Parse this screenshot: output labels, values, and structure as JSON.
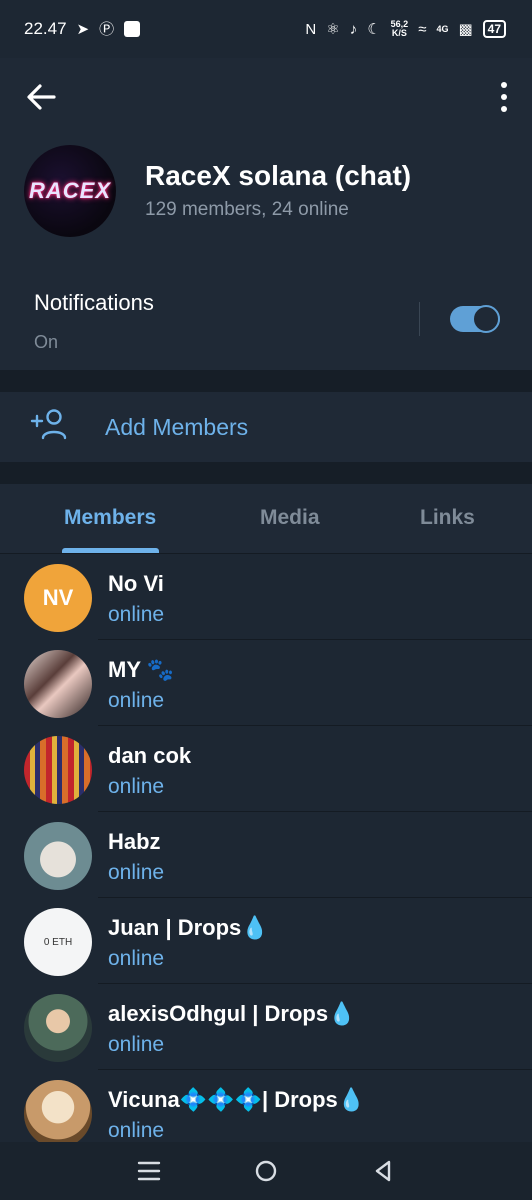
{
  "status_bar": {
    "time": "22.47",
    "speed_value": "56,2",
    "speed_unit": "K/S",
    "network": "4G",
    "battery": "47"
  },
  "header": {
    "group_logo_text": "RACEX",
    "title": "RaceX solana (chat)",
    "subtitle": "129 members, 24 online"
  },
  "notifications": {
    "title": "Notifications",
    "state": "On",
    "enabled": true
  },
  "add_members": {
    "label": "Add Members"
  },
  "tabs": [
    {
      "label": "Members",
      "active": true
    },
    {
      "label": "Media",
      "active": false
    },
    {
      "label": "Links",
      "active": false
    }
  ],
  "members": [
    {
      "name": "No Vi",
      "initials": "NV",
      "status": "online",
      "avatar_color": "#f0a43a"
    },
    {
      "name": "MY",
      "status": "online",
      "suffix_icon": "paw-icon"
    },
    {
      "name": "dan cok",
      "status": "online"
    },
    {
      "name": "Habz",
      "status": "online"
    },
    {
      "name": "Juan | Drops",
      "status": "online",
      "suffix_icon": "droplet-icon",
      "avatar_text": "0 ETH"
    },
    {
      "name": "alexisOdhgul | Drops",
      "status": "online",
      "suffix_icon": "droplet-icon"
    },
    {
      "name_prefix": "Vicuna",
      "name_suffix": "| Drops",
      "status": "online",
      "icons": [
        "diamond-icon",
        "diamond-icon",
        "diamond-icon",
        "droplet-icon"
      ]
    }
  ],
  "colors": {
    "accent": "#6eb2ea",
    "background": "#1d2733",
    "secondary_text": "#8e9aa8"
  }
}
